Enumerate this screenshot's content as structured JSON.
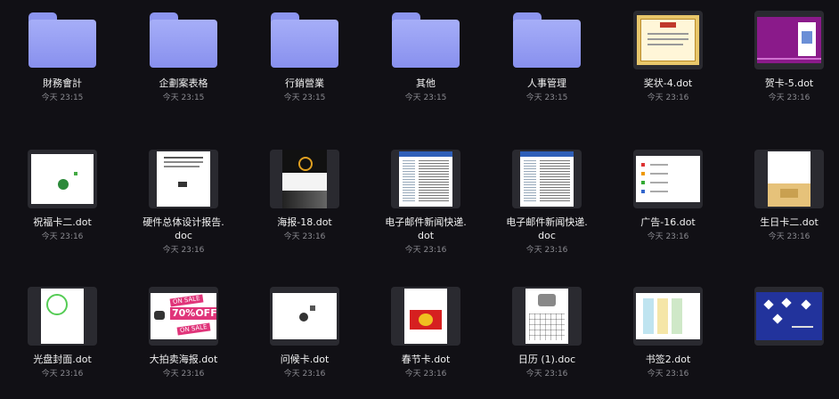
{
  "items": [
    {
      "type": "folder",
      "name": "財務會計",
      "time": "今天 23:15"
    },
    {
      "type": "folder",
      "name": "企劃案表格",
      "time": "今天 23:15"
    },
    {
      "type": "folder",
      "name": "行銷營業",
      "time": "今天 23:15"
    },
    {
      "type": "folder",
      "name": "其他",
      "time": "今天 23:15"
    },
    {
      "type": "folder",
      "name": "人事管理",
      "time": "今天 23:15"
    },
    {
      "type": "file",
      "name": "奖状-4.dot",
      "time": "今天 23:16",
      "preview": "certificate"
    },
    {
      "type": "file",
      "name": "贺卡-5.dot",
      "time": "今天 23:16",
      "preview": "purple-card"
    },
    {
      "type": "file",
      "name": "祝福卡二.dot",
      "time": "今天 23:16",
      "preview": "blessing-card"
    },
    {
      "type": "file",
      "name": "硬件总体设计报告.doc",
      "time": "今天 23:16",
      "preview": "report"
    },
    {
      "type": "file",
      "name": "海报-18.dot",
      "time": "今天 23:16",
      "preview": "poster"
    },
    {
      "type": "file",
      "name": "电子邮件新闻快递.dot",
      "time": "今天 23:16",
      "preview": "newsletter"
    },
    {
      "type": "file",
      "name": "电子邮件新闻快递.doc",
      "time": "今天 23:16",
      "preview": "newsletter"
    },
    {
      "type": "file",
      "name": "广告-16.dot",
      "time": "今天 23:16",
      "preview": "ad"
    },
    {
      "type": "file",
      "name": "生日卡二.dot",
      "time": "今天 23:16",
      "preview": "birthday"
    },
    {
      "type": "file",
      "name": "光盘封面.dot",
      "time": "今天 23:16",
      "preview": "cd-cover"
    },
    {
      "type": "file",
      "name": "大拍卖海报.dot",
      "time": "今天 23:16",
      "preview": "sale",
      "preview_text": {
        "top": "ON SALE",
        "mid": "70%OFF",
        "bot": "ON SALE"
      }
    },
    {
      "type": "file",
      "name": "问候卡.dot",
      "time": "今天 23:16",
      "preview": "greeting"
    },
    {
      "type": "file",
      "name": "春节卡.dot",
      "time": "今天 23:16",
      "preview": "spring"
    },
    {
      "type": "file",
      "name": "日历 (1).doc",
      "time": "今天 23:16",
      "preview": "calendar"
    },
    {
      "type": "file",
      "name": "书签2.dot",
      "time": "今天 23:16",
      "preview": "bookmark"
    },
    {
      "type": "file",
      "name": "",
      "time": "",
      "preview": "newyear"
    }
  ],
  "colors": {
    "background": "#111015",
    "folder": "#8c95f0",
    "name_text": "#f2f2f2",
    "time_text": "#8a8a90"
  }
}
